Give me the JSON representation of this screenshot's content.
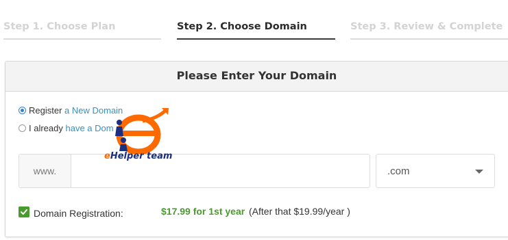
{
  "steps": [
    {
      "label": "Step 1. Choose Plan",
      "state": "inactive"
    },
    {
      "label": "Step 2. Choose Domain",
      "state": "active"
    },
    {
      "label": "Step 3. Review & Complete",
      "state": "inactive"
    }
  ],
  "panel": {
    "title": "Please Enter Your Domain"
  },
  "options": {
    "register": {
      "prefix": "Register ",
      "link": "a New Domain",
      "checked": true
    },
    "existing": {
      "prefix": "I already ",
      "link": "have a Dom",
      "checked": false
    }
  },
  "domain": {
    "prefix": "www.",
    "value": "",
    "tld": ".com"
  },
  "registration": {
    "label": "Domain Registration:",
    "price": "$17.99 for 1st year",
    "renewal": "(After that $19.99/year )",
    "checked": true
  },
  "watermark": {
    "text_e": "e",
    "text_rest": "Helper team"
  },
  "colors": {
    "accent_blue": "#2f7fd6",
    "link": "#3a8fbf",
    "price_green": "#4b9a2f",
    "watermark_orange": "#ff6a00",
    "watermark_navy": "#1a2f80"
  }
}
